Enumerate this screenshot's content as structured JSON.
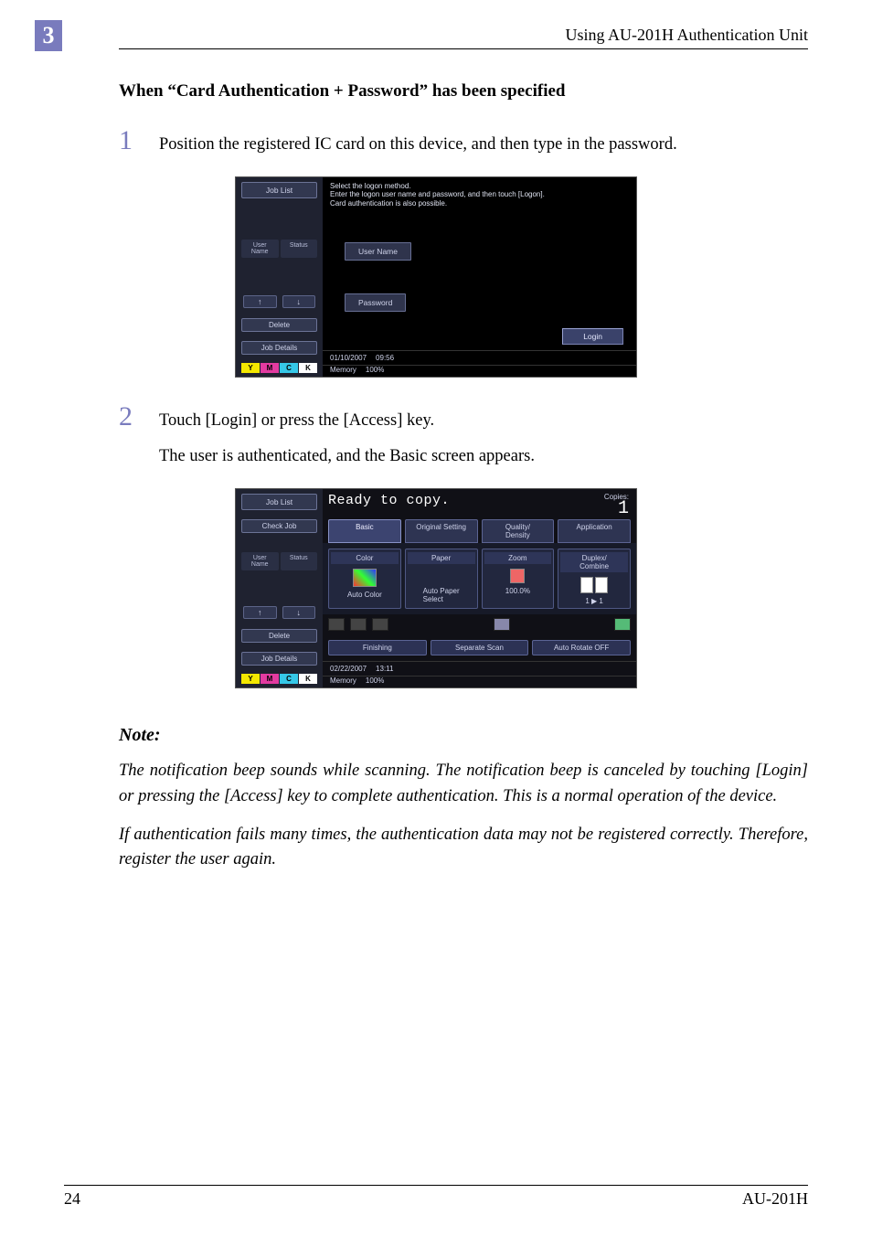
{
  "page": {
    "chapter_number": "3",
    "header_text": "Using AU-201H Authentication Unit",
    "footer_left": "24",
    "footer_right": "AU-201H"
  },
  "section_heading": "When “Card Authentication + Password” has been specified",
  "steps": [
    {
      "num": "1",
      "lines": [
        "Position the registered IC card on this device, and then type in the password."
      ]
    },
    {
      "num": "2",
      "lines": [
        "Touch [Login] or press the [Access] key.",
        "The user is authenticated, and the Basic screen appears."
      ]
    }
  ],
  "note": {
    "label": "Note:",
    "paras": [
      "The notification beep sounds while scanning. The notification beep is canceled by touching [Login] or pressing the [Access] key to complete authentication. This is a normal operation of the device.",
      "If authentication fails many times, the authentication data may not be registered correctly. Therefore, register the user again."
    ]
  },
  "shot1": {
    "side": {
      "job_list": "Job List",
      "user": "User\nName",
      "status": "Status",
      "delete": "Delete",
      "job_details": "Job Details",
      "arrow_up": "↑",
      "arrow_down": "↓"
    },
    "msg_l1": "Select the logon method.",
    "msg_l2": "Enter the logon user name and password, and then touch [Logon].",
    "msg_l3": "Card authentication is also possible.",
    "user_name_label": "User Name",
    "password_label": "Password",
    "login_btn": "Login",
    "date": "01/10/2007",
    "time": "09:56",
    "memory_label": "Memory",
    "memory_val": "100%"
  },
  "shot2": {
    "side": {
      "job_list": "Job List",
      "check_job": "Check Job",
      "user": "User\nName",
      "status": "Status",
      "delete": "Delete",
      "job_details": "Job Details",
      "arrow_up": "↑",
      "arrow_down": "↓"
    },
    "ready": "Ready to copy.",
    "copies_label": "Copies:",
    "copies_value": "1",
    "tabs": [
      "Basic",
      "Original Setting",
      "Quality/\nDensity",
      "Application"
    ],
    "tiles": {
      "color": {
        "label": "Color",
        "value": "Auto Color"
      },
      "paper": {
        "label": "Paper",
        "value": "Auto Paper\nSelect"
      },
      "zoom": {
        "label": "Zoom",
        "value": "100.0%"
      },
      "duplex": {
        "label": "Duplex/\nCombine",
        "value": "1 ▶ 1"
      }
    },
    "controls": [
      "Finishing",
      "Separate Scan",
      "Auto Rotate OFF"
    ],
    "date": "02/22/2007",
    "time": "13:11",
    "memory_label": "Memory",
    "memory_val": "100%"
  },
  "ymck": {
    "y": "Y",
    "m": "M",
    "c": "C",
    "k": "K"
  }
}
